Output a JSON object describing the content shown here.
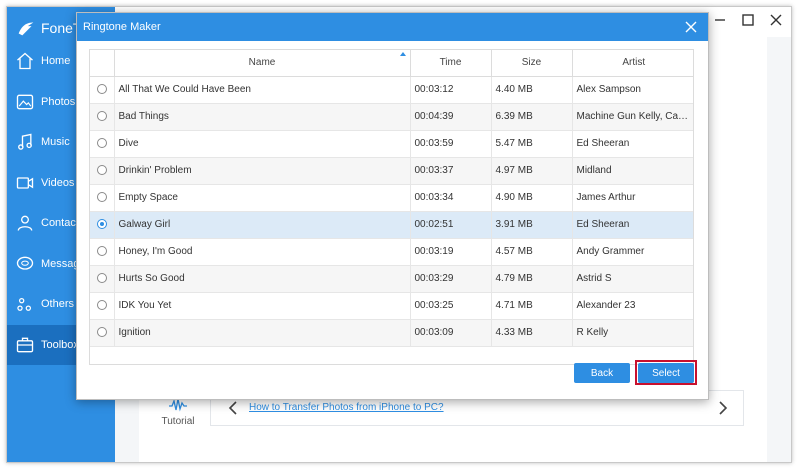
{
  "app": {
    "logo_text": "FoneT",
    "nav": [
      {
        "label": "Home",
        "icon": "home-icon"
      },
      {
        "label": "Photos",
        "icon": "photos-icon"
      },
      {
        "label": "Music",
        "icon": "music-icon"
      },
      {
        "label": "Videos",
        "icon": "videos-icon"
      },
      {
        "label": "Contacts",
        "icon": "contacts-icon"
      },
      {
        "label": "Messages",
        "icon": "messages-icon"
      },
      {
        "label": "Others",
        "icon": "others-icon"
      },
      {
        "label": "Toolbox",
        "icon": "toolbox-icon",
        "active": true
      }
    ],
    "tutorial_label": "Tutorial",
    "tutorial_link": "How to Transfer Photos from iPhone to PC?"
  },
  "dialog": {
    "title": "Ringtone Maker",
    "columns": [
      "Name",
      "Time",
      "Size",
      "Artist"
    ],
    "rows": [
      {
        "name": "All That We Could Have Been",
        "time": "00:03:12",
        "size": "4.40 MB",
        "artist": "Alex Sampson"
      },
      {
        "name": "Bad Things",
        "time": "00:04:39",
        "size": "6.39 MB",
        "artist": "Machine Gun Kelly, Camila C..."
      },
      {
        "name": "Dive",
        "time": "00:03:59",
        "size": "5.47 MB",
        "artist": "Ed Sheeran"
      },
      {
        "name": "Drinkin' Problem",
        "time": "00:03:37",
        "size": "4.97 MB",
        "artist": "Midland"
      },
      {
        "name": "Empty Space",
        "time": "00:03:34",
        "size": "4.90 MB",
        "artist": "James Arthur"
      },
      {
        "name": "Galway Girl",
        "time": "00:02:51",
        "size": "3.91 MB",
        "artist": "Ed Sheeran",
        "selected": true
      },
      {
        "name": "Honey, I'm Good",
        "time": "00:03:19",
        "size": "4.57 MB",
        "artist": "Andy Grammer"
      },
      {
        "name": "Hurts So Good",
        "time": "00:03:29",
        "size": "4.79 MB",
        "artist": "Astrid S"
      },
      {
        "name": "IDK You Yet",
        "time": "00:03:25",
        "size": "4.71 MB",
        "artist": "Alexander 23"
      },
      {
        "name": "Ignition",
        "time": "00:03:09",
        "size": "4.33 MB",
        "artist": "R Kelly"
      }
    ],
    "back_label": "Back",
    "select_label": "Select"
  },
  "colors": {
    "accent": "#2e8ee2",
    "highlight_border": "#c8102e",
    "selected_row": "#dceaf7"
  }
}
